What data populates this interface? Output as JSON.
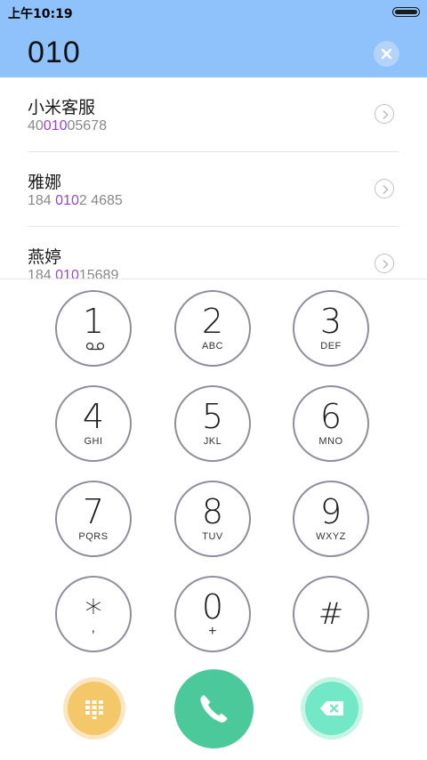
{
  "status_bar": {
    "time": "上午10:19"
  },
  "dial_input": {
    "value": "010"
  },
  "contacts": [
    {
      "name": "小米客服",
      "number_pre": "40",
      "number_match": "010",
      "number_post": "05678"
    },
    {
      "name": "雅娜",
      "number_pre": "184 ",
      "number_match": "010",
      "number_post": "2 4685"
    },
    {
      "name": "燕婷",
      "number_pre": "184 ",
      "number_match": "010",
      "number_post": "15689"
    }
  ],
  "keys": [
    {
      "digit": "1",
      "letters": ""
    },
    {
      "digit": "2",
      "letters": "ABC"
    },
    {
      "digit": "3",
      "letters": "DEF"
    },
    {
      "digit": "4",
      "letters": "GHI"
    },
    {
      "digit": "5",
      "letters": "JKL"
    },
    {
      "digit": "6",
      "letters": "MNO"
    },
    {
      "digit": "7",
      "letters": "PQRS"
    },
    {
      "digit": "8",
      "letters": "TUV"
    },
    {
      "digit": "9",
      "letters": "WXYZ"
    },
    {
      "digit": "*",
      "letters": ","
    },
    {
      "digit": "0",
      "letters": "+"
    },
    {
      "digit": "#",
      "letters": ""
    }
  ],
  "colors": {
    "header": "#8fc1fb",
    "highlight": "#9b3fe0",
    "keypad_button": "#f4c768",
    "call_button": "#4bc99a",
    "delete_button": "#72e8c6"
  },
  "icons": {
    "voicemail": "voicemail-icon",
    "keypad": "keypad-grid-icon",
    "call": "phone-icon",
    "delete": "backspace-icon",
    "clear": "close-icon",
    "detail": "chevron-right-icon"
  }
}
